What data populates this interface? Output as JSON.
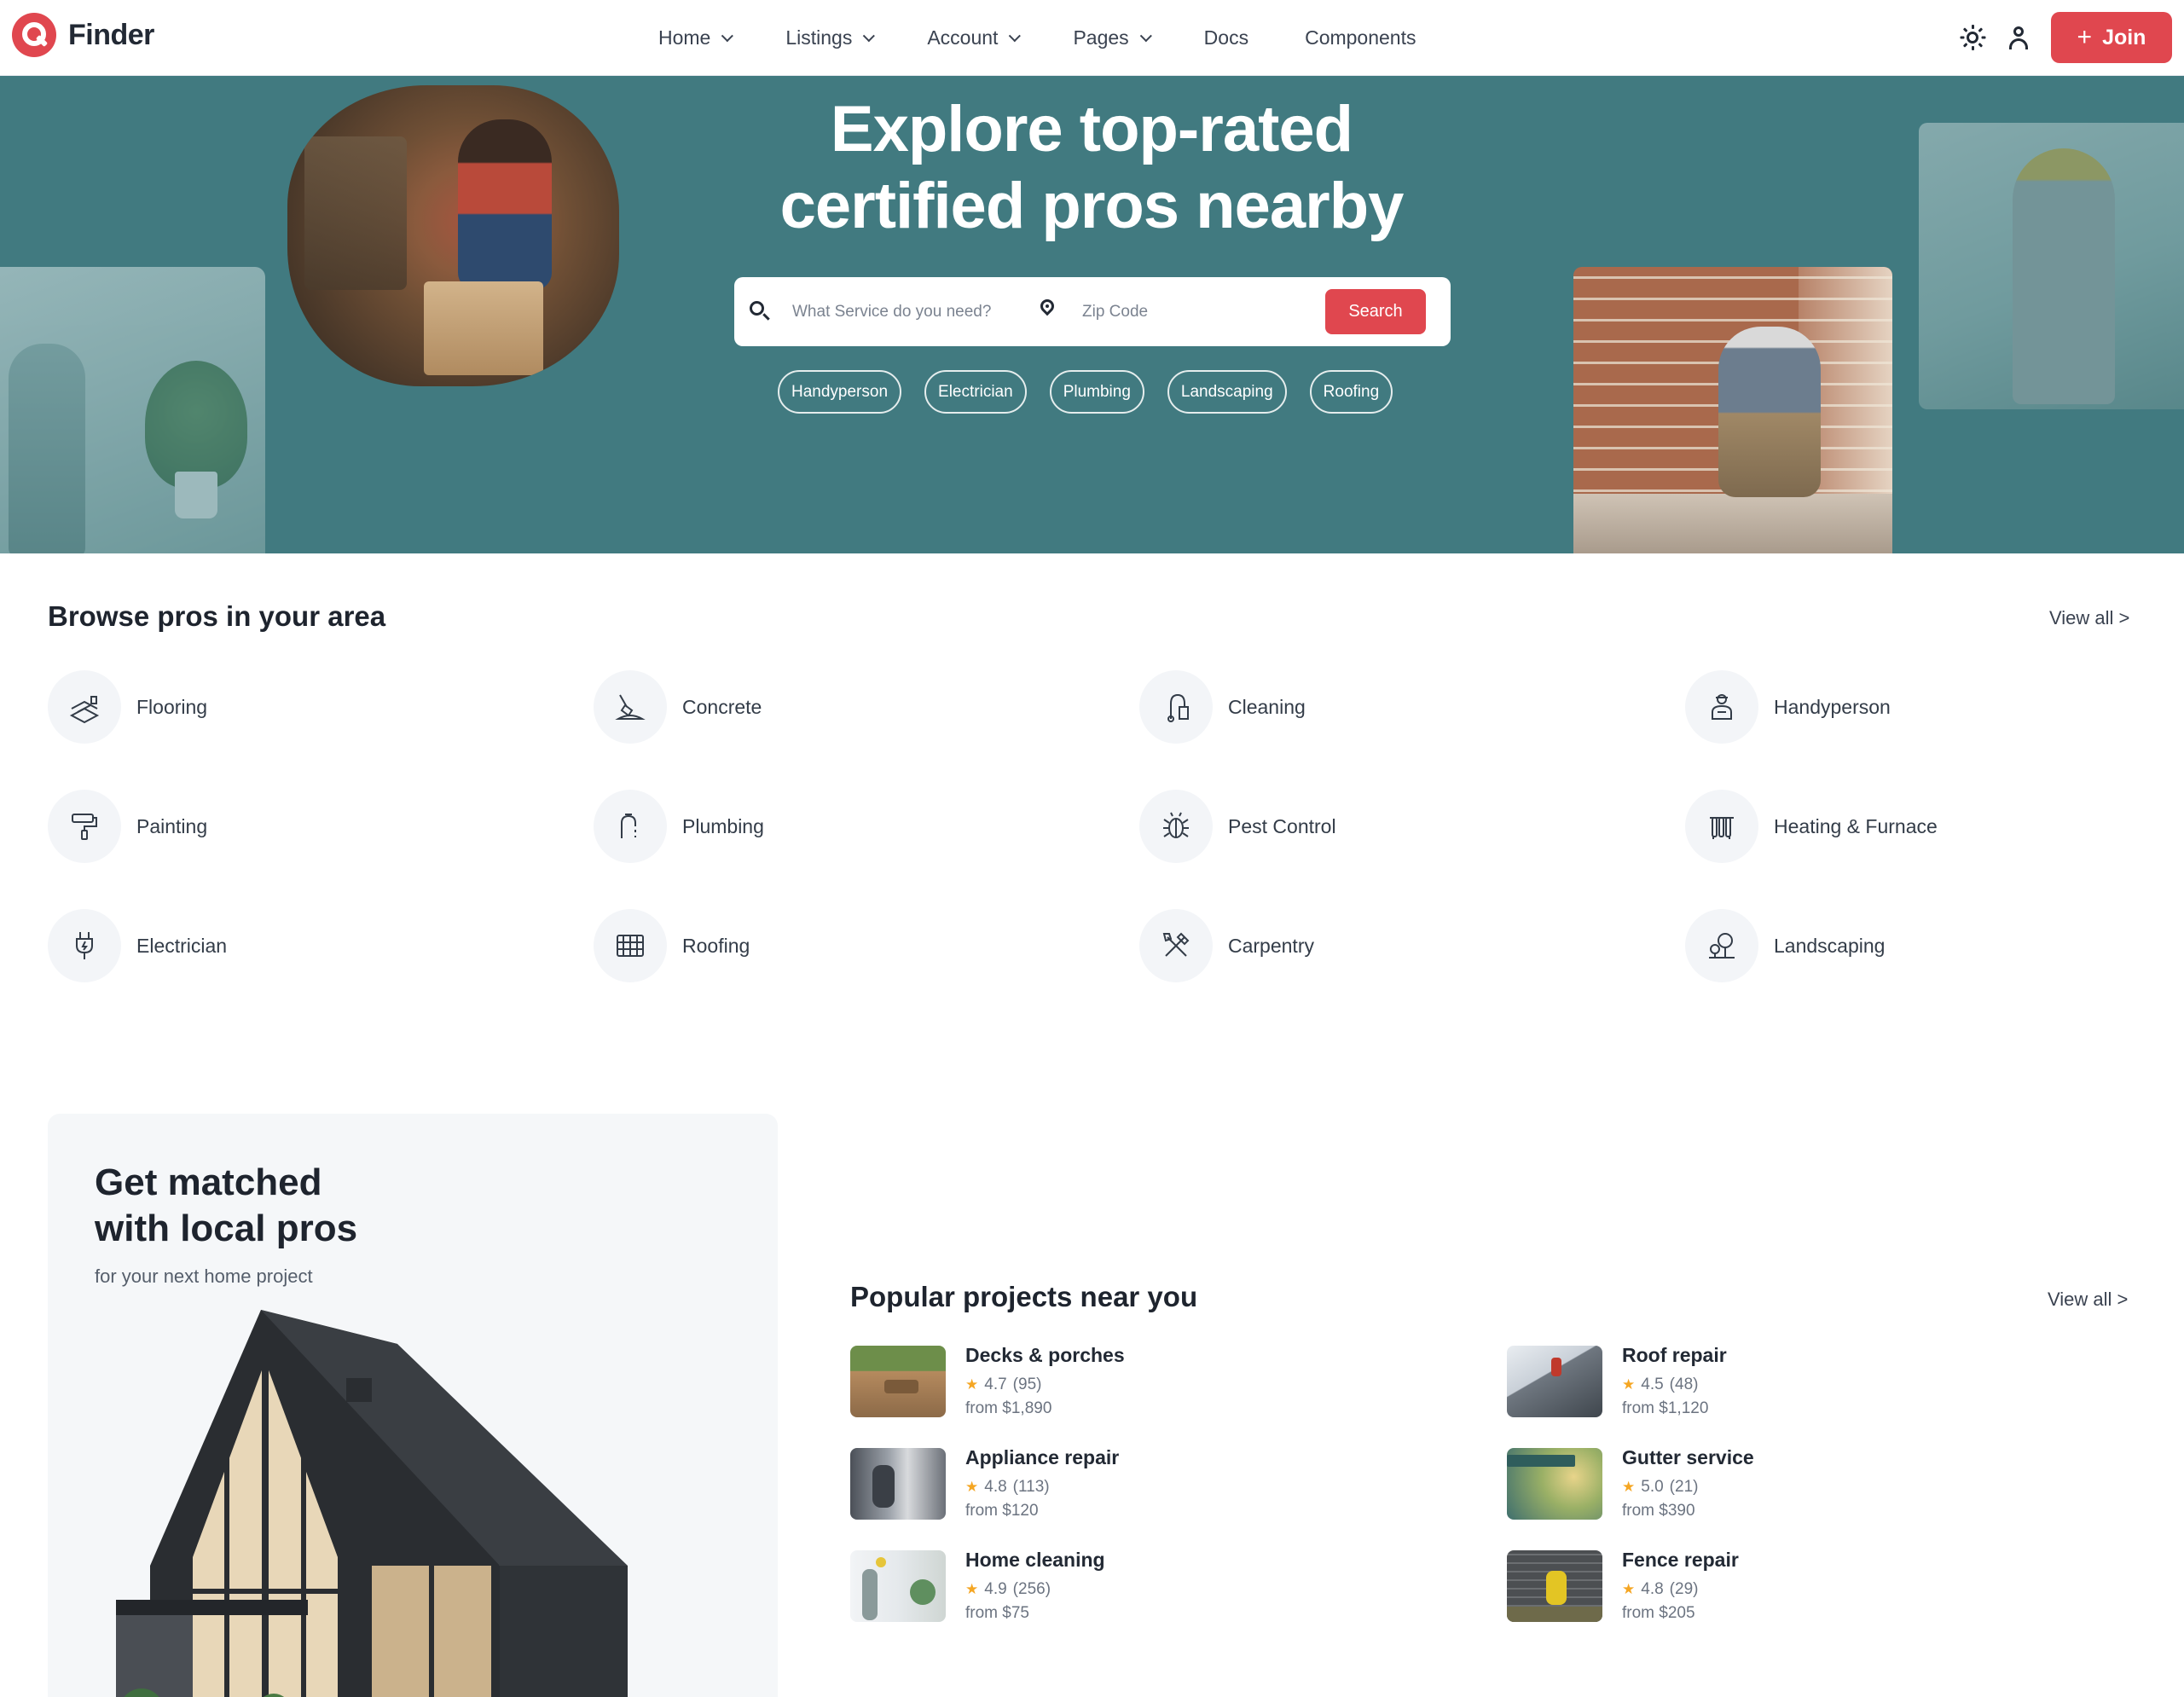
{
  "brand": {
    "name": "Finder"
  },
  "nav": {
    "items": [
      {
        "label": "Home",
        "has_dropdown": true
      },
      {
        "label": "Listings",
        "has_dropdown": true
      },
      {
        "label": "Account",
        "has_dropdown": true
      },
      {
        "label": "Pages",
        "has_dropdown": true
      },
      {
        "label": "Docs",
        "has_dropdown": false
      },
      {
        "label": "Components",
        "has_dropdown": false
      }
    ],
    "join_label": "Join"
  },
  "hero": {
    "title_line1": "Explore top-rated",
    "title_line2": "certified pros nearby",
    "search": {
      "service_placeholder": "What Service do you need?",
      "zip_placeholder": "Zip Code",
      "button_label": "Search"
    },
    "tags": [
      "Handyperson",
      "Electrician",
      "Plumbing",
      "Landscaping",
      "Roofing"
    ]
  },
  "browse": {
    "title": "Browse pros in your area",
    "view_all": "View all >",
    "categories": [
      {
        "label": "Flooring",
        "icon": "flooring-icon"
      },
      {
        "label": "Concrete",
        "icon": "concrete-icon"
      },
      {
        "label": "Cleaning",
        "icon": "cleaning-icon"
      },
      {
        "label": "Handyperson",
        "icon": "handyperson-icon"
      },
      {
        "label": "Painting",
        "icon": "paint-roller-icon"
      },
      {
        "label": "Plumbing",
        "icon": "faucet-icon"
      },
      {
        "label": "Pest Control",
        "icon": "bug-icon"
      },
      {
        "label": "Heating & Furnace",
        "icon": "radiator-icon"
      },
      {
        "label": "Electrician",
        "icon": "plug-icon"
      },
      {
        "label": "Roofing",
        "icon": "roof-tiles-icon"
      },
      {
        "label": "Carpentry",
        "icon": "tools-icon"
      },
      {
        "label": "Landscaping",
        "icon": "tree-icon"
      }
    ]
  },
  "promo": {
    "title_line1": "Get matched",
    "title_line2": "with local pros",
    "subtitle": "for your next home project"
  },
  "projects": {
    "title": "Popular projects near you",
    "view_all": "View all >",
    "items": [
      {
        "name": "Decks & porches",
        "rating": "4.7",
        "reviews": "(95)",
        "price": "from $1,890"
      },
      {
        "name": "Roof repair",
        "rating": "4.5",
        "reviews": "(48)",
        "price": "from $1,120"
      },
      {
        "name": "Appliance repair",
        "rating": "4.8",
        "reviews": "(113)",
        "price": "from $120"
      },
      {
        "name": "Gutter service",
        "rating": "5.0",
        "reviews": "(21)",
        "price": "from $390"
      },
      {
        "name": "Home cleaning",
        "rating": "4.9",
        "reviews": "(256)",
        "price": "from $75"
      },
      {
        "name": "Fence repair",
        "rating": "4.8",
        "reviews": "(29)",
        "price": "from $205"
      }
    ]
  },
  "colors": {
    "accent": "#e0474f",
    "hero_bg": "#417a80",
    "star": "#f5a623"
  }
}
